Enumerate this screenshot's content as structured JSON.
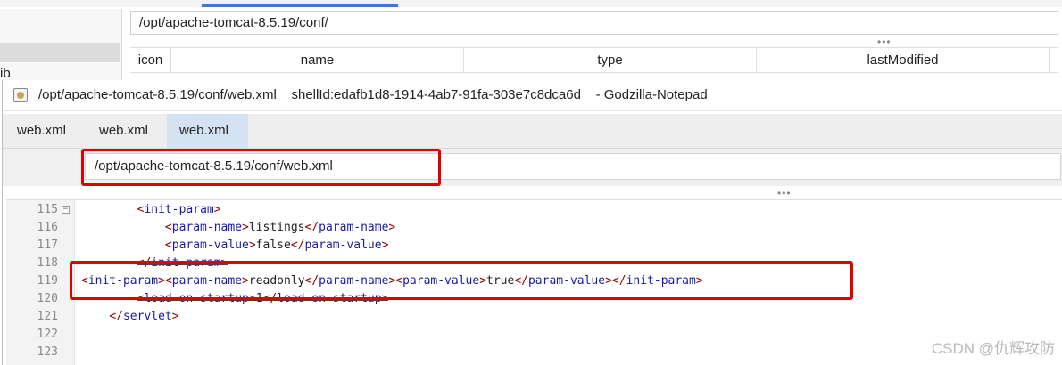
{
  "file_manager": {
    "path": "/opt/apache-tomcat-8.5.19/conf/",
    "left_panel_text": "ib",
    "columns": [
      "icon",
      "name",
      "type",
      "lastModified"
    ]
  },
  "notepad": {
    "title": {
      "path": "/opt/apache-tomcat-8.5.19/conf/web.xml",
      "shell_id": "shellId:edafb1d8-1914-4ab7-91fa-303e7c8dca6d",
      "app_name": "- Godzilla-Notepad"
    },
    "tabs": [
      {
        "label": "web.xml",
        "active": false
      },
      {
        "label": "web.xml",
        "active": false
      },
      {
        "label": "web.xml",
        "active": true
      }
    ],
    "path_input": "/opt/apache-tomcat-8.5.19/conf/web.xml",
    "code_lines": [
      {
        "num": "115",
        "indent": "        ",
        "segments": [
          [
            "t",
            "<"
          ],
          [
            "n",
            "init-param"
          ],
          [
            "t",
            ">"
          ]
        ],
        "fold": true
      },
      {
        "num": "116",
        "indent": "            ",
        "segments": [
          [
            "t",
            "<"
          ],
          [
            "n",
            "param-name"
          ],
          [
            "t",
            ">"
          ],
          [
            "x",
            "listings"
          ],
          [
            "t",
            "</"
          ],
          [
            "n",
            "param-name"
          ],
          [
            "t",
            ">"
          ]
        ]
      },
      {
        "num": "117",
        "indent": "            ",
        "segments": [
          [
            "t",
            "<"
          ],
          [
            "n",
            "param-value"
          ],
          [
            "t",
            ">"
          ],
          [
            "x",
            "false"
          ],
          [
            "t",
            "</"
          ],
          [
            "n",
            "param-value"
          ],
          [
            "t",
            ">"
          ]
        ]
      },
      {
        "num": "118",
        "indent": "        ",
        "segments": [
          [
            "t",
            "</"
          ],
          [
            "n",
            "init-param"
          ],
          [
            "t",
            ">"
          ]
        ],
        "struck": true
      },
      {
        "num": "119",
        "indent": "",
        "segments": [
          [
            "t",
            "<"
          ],
          [
            "n",
            "init-param"
          ],
          [
            "t",
            ">"
          ],
          [
            "t",
            "<"
          ],
          [
            "n",
            "param-name"
          ],
          [
            "t",
            ">"
          ],
          [
            "x",
            "readonly"
          ],
          [
            "t",
            "</"
          ],
          [
            "n",
            "param-name"
          ],
          [
            "t",
            ">"
          ],
          [
            "t",
            "<"
          ],
          [
            "n",
            "param-value"
          ],
          [
            "t",
            ">"
          ],
          [
            "x",
            "true"
          ],
          [
            "t",
            "</"
          ],
          [
            "n",
            "param-value"
          ],
          [
            "t",
            ">"
          ],
          [
            "t",
            "</"
          ],
          [
            "n",
            "init-param"
          ],
          [
            "t",
            ">"
          ]
        ]
      },
      {
        "num": "120",
        "indent": "        ",
        "segments": [
          [
            "t",
            "<"
          ],
          [
            "n",
            "load-on-startup"
          ],
          [
            "t",
            ">"
          ],
          [
            "x",
            "1"
          ],
          [
            "t",
            "</"
          ],
          [
            "n",
            "load-on-startup"
          ],
          [
            "t",
            ">"
          ]
        ],
        "struck": true
      },
      {
        "num": "121",
        "indent": "    ",
        "segments": [
          [
            "t",
            "</"
          ],
          [
            "n",
            "servlet"
          ],
          [
            "t",
            ">"
          ]
        ]
      },
      {
        "num": "122",
        "indent": "",
        "segments": []
      },
      {
        "num": "123",
        "indent": "",
        "segments": []
      }
    ]
  },
  "watermark": "CSDN @仇辉攻防",
  "colors": {
    "highlight_box": "#e00000",
    "xml_bracket": "#8b0000",
    "xml_tagname": "#1a1aa6",
    "active_tab": "#d3e3f1"
  }
}
